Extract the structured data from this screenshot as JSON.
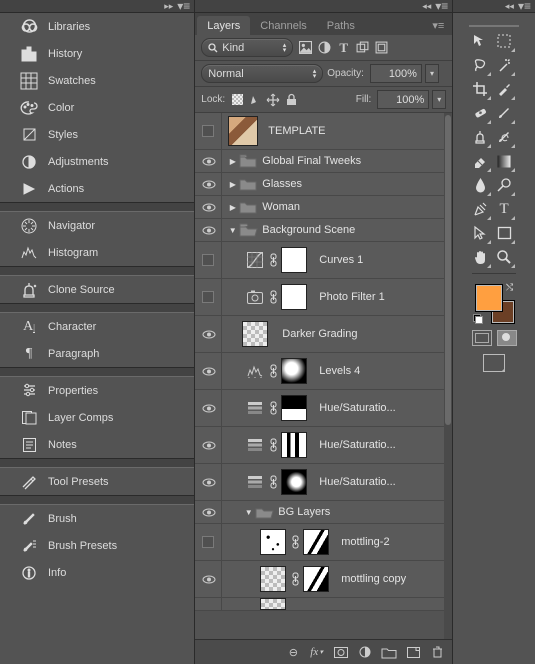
{
  "left": {
    "items": [
      {
        "label": "Libraries",
        "icon": "libraries"
      },
      {
        "label": "History",
        "icon": "history"
      },
      {
        "label": "Swatches",
        "icon": "swatches"
      },
      {
        "label": "Color",
        "icon": "color"
      },
      {
        "label": "Styles",
        "icon": "styles"
      },
      {
        "label": "Adjustments",
        "icon": "adjustments"
      },
      {
        "label": "Actions",
        "icon": "actions"
      },
      "div",
      {
        "label": "Navigator",
        "icon": "navigator"
      },
      {
        "label": "Histogram",
        "icon": "histogram"
      },
      "div",
      {
        "label": "Clone Source",
        "icon": "clone-source"
      },
      "div",
      {
        "label": "Character",
        "icon": "character"
      },
      {
        "label": "Paragraph",
        "icon": "paragraph"
      },
      "div",
      {
        "label": "Properties",
        "icon": "properties"
      },
      {
        "label": "Layer Comps",
        "icon": "layer-comps"
      },
      {
        "label": "Notes",
        "icon": "notes"
      },
      "div",
      {
        "label": "Tool Presets",
        "icon": "tool-presets"
      },
      "div",
      {
        "label": "Brush",
        "icon": "brush"
      },
      {
        "label": "Brush Presets",
        "icon": "brush-presets"
      },
      {
        "label": "Info",
        "icon": "info"
      }
    ]
  },
  "tabs": {
    "layers": "Layers",
    "channels": "Channels",
    "paths": "Paths"
  },
  "filter": {
    "label": "Kind"
  },
  "blend": {
    "mode": "Normal",
    "opacity_label": "Opacity:",
    "opacity": "100%",
    "fill_label": "Fill:",
    "fill": "100%",
    "lock_label": "Lock:"
  },
  "layers": {
    "template": "TEMPLATE",
    "global": "Global Final Tweeks",
    "glasses": "Glasses",
    "woman": "Woman",
    "bgscene": "Background Scene",
    "curves": "Curves 1",
    "photofilter": "Photo Filter 1",
    "darker": "Darker Grading",
    "levels": "Levels 4",
    "hue1": "Hue/Saturatio...",
    "hue2": "Hue/Saturatio...",
    "hue3": "Hue/Saturatio...",
    "bglayers": "BG Layers",
    "mott2": "mottling-2",
    "mottcopy": "mottling copy"
  }
}
